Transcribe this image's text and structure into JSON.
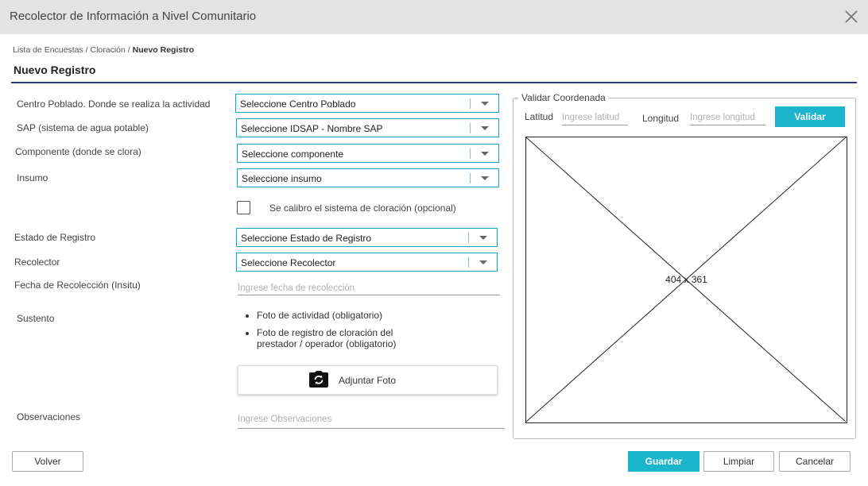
{
  "window": {
    "title": "Recolector de Información a Nivel Comunitario"
  },
  "breadcrumb": {
    "items": [
      "Lista de Encuestas",
      "Cloración"
    ],
    "separator": " / ",
    "current": "Nuevo Registro"
  },
  "page": {
    "title": "Nuevo Registro"
  },
  "form": {
    "centro_poblado": {
      "label": "Centro Poblado. Donde se realiza la actividad",
      "value": "Seleccione Centro Poblado"
    },
    "sap": {
      "label": "SAP (sistema de agua potable)",
      "value": "Seleccione IDSAP - Nombre SAP"
    },
    "componente": {
      "label": "Componente (donde se clora)",
      "value": "Seleccione componente"
    },
    "insumo": {
      "label": "Insumo",
      "value": "Seleccione insumo"
    },
    "calibro": {
      "label": "Se calibro el sistema de cloración (opcional)",
      "checked": false
    },
    "estado": {
      "label": "Estado de Registro",
      "value": "Seleccione Estado de Registro"
    },
    "recolector": {
      "label": "Recolector",
      "value": "Seleccione Recolector"
    },
    "fecha": {
      "label": "Fecha de Recolección (Insitu)",
      "placeholder": "Ingrese fecha de recolección",
      "value": ""
    },
    "sustento": {
      "label": "Sustento",
      "items": [
        "Foto de actividad (obligatorio)",
        "Foto de registro de cloración del prestador / operador (obligatorio)"
      ]
    },
    "adjuntar": {
      "label": "Adjuntar Foto",
      "icon": "camera-icon"
    },
    "observaciones": {
      "label": "Observaciones",
      "placeholder": "Ingrese Observaciones",
      "value": ""
    }
  },
  "coords": {
    "legend": "Validar Coordenada",
    "lat_label": "Latitud",
    "lat_placeholder": "Ingrese latitud",
    "lng_label": "Longitud",
    "lng_placeholder": "Ingrese longitud",
    "validate_label": "Validar",
    "map_placeholder": "404 x 361"
  },
  "footer": {
    "back": "Volver",
    "save": "Guardar",
    "clear": "Limpiar",
    "cancel": "Cancelar"
  },
  "colors": {
    "accent": "#1cb6cc",
    "title_rule": "#2d3a8c",
    "select_border": "#0aa9c3",
    "titlebar": "#e3e3e3"
  }
}
